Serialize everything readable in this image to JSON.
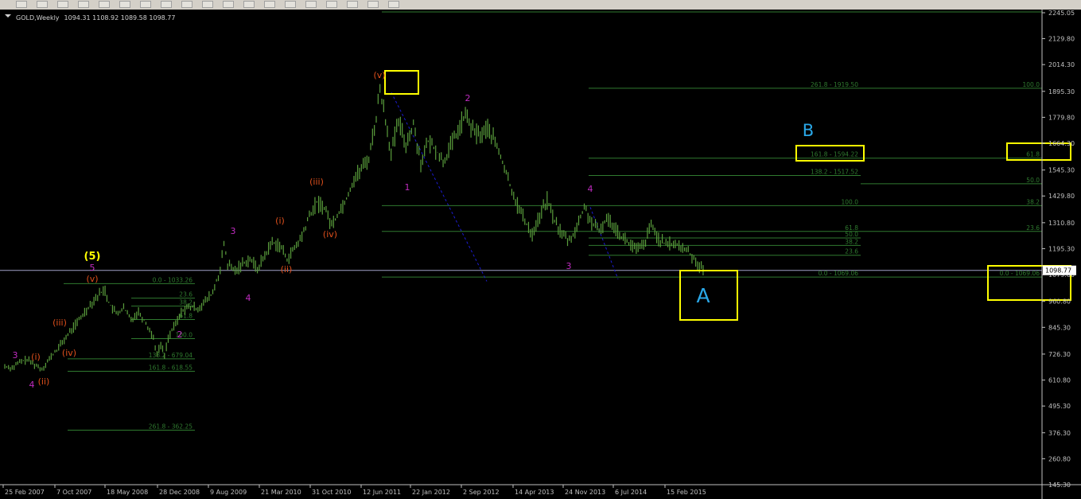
{
  "window": {
    "symbol_header": "GOLD,Weekly",
    "ohlc": "1094.31 1108.92 1089.58 1098.77",
    "current_price": "1098.77"
  },
  "toolbar": {
    "buttons": [
      "crosshair",
      "period-sep",
      "zoom-in",
      "zoom-out",
      "tile",
      "add-indicator",
      "globe",
      "fib-expansion",
      "fib-fan",
      "shapes",
      "M1",
      "M5",
      "M15",
      "M30",
      "H1",
      "H4",
      "D1",
      "W1",
      "MN"
    ]
  },
  "chart_data": {
    "type": "line",
    "title": "",
    "ylim": [
      145.3,
      2245.05
    ],
    "y_ticks": [
      2245.05,
      2129.8,
      2014.3,
      1895.3,
      1779.8,
      1664.3,
      1545.3,
      1429.8,
      1310.8,
      1195.3,
      1079.8,
      960.8,
      845.3,
      726.3,
      610.8,
      495.3,
      376.3,
      260.8,
      145.3
    ],
    "y_tick_labels": [
      "2245.05",
      "2129.80",
      "2014.30",
      "1895.30",
      "1779.80",
      "1664.30",
      "1545.30",
      "1429.80",
      "1310.80",
      "1195.30",
      "1079.80",
      "960.80",
      "845.30",
      "726.30",
      "610.80",
      "495.30",
      "376.30",
      "260.80",
      "145.30"
    ],
    "x_tick_labels": [
      "25 Feb 2007",
      "7 Oct 2007",
      "18 May 2008",
      "28 Dec 2008",
      "9 Aug 2009",
      "21 Mar 2010",
      "31 Oct 2010",
      "12 Jun 2011",
      "22 Jan 2012",
      "2 Sep 2012",
      "14 Apr 2013",
      "24 Nov 2013",
      "6 Jul 2014",
      "15 Feb 2015"
    ],
    "series": [
      {
        "values": [
          [
            0,
            672
          ],
          [
            2,
            665
          ],
          [
            4,
            690
          ],
          [
            6,
            702
          ],
          [
            8,
            680
          ],
          [
            10,
            660
          ],
          [
            12,
            705
          ],
          [
            14,
            745
          ],
          [
            16,
            790
          ],
          [
            18,
            835
          ],
          [
            20,
            878
          ],
          [
            22,
            925
          ],
          [
            24,
            968
          ],
          [
            26,
            1003
          ],
          [
            27,
            1011
          ],
          [
            28,
            955
          ],
          [
            30,
            905
          ],
          [
            32,
            930
          ],
          [
            34,
            880
          ],
          [
            36,
            915
          ],
          [
            38,
            865
          ],
          [
            40,
            800
          ],
          [
            41,
            725
          ],
          [
            42,
            770
          ],
          [
            43,
            720
          ],
          [
            44,
            800
          ],
          [
            46,
            860
          ],
          [
            48,
            925
          ],
          [
            50,
            935
          ],
          [
            52,
            930
          ],
          [
            54,
            960
          ],
          [
            56,
            1000
          ],
          [
            58,
            1100
          ],
          [
            59,
            1215
          ],
          [
            60,
            1125
          ],
          [
            62,
            1095
          ],
          [
            64,
            1130
          ],
          [
            66,
            1150
          ],
          [
            68,
            1105
          ],
          [
            70,
            1165
          ],
          [
            72,
            1225
          ],
          [
            74,
            1210
          ],
          [
            76,
            1150
          ],
          [
            78,
            1195
          ],
          [
            80,
            1250
          ],
          [
            82,
            1340
          ],
          [
            84,
            1400
          ],
          [
            86,
            1380
          ],
          [
            88,
            1300
          ],
          [
            90,
            1360
          ],
          [
            92,
            1420
          ],
          [
            94,
            1505
          ],
          [
            96,
            1550
          ],
          [
            98,
            1600
          ],
          [
            100,
            1780
          ],
          [
            101,
            1905
          ],
          [
            102,
            1820
          ],
          [
            104,
            1620
          ],
          [
            106,
            1760
          ],
          [
            108,
            1660
          ],
          [
            110,
            1750
          ],
          [
            112,
            1580
          ],
          [
            114,
            1670
          ],
          [
            116,
            1640
          ],
          [
            118,
            1580
          ],
          [
            120,
            1650
          ],
          [
            122,
            1720
          ],
          [
            124,
            1790
          ],
          [
            126,
            1720
          ],
          [
            128,
            1700
          ],
          [
            130,
            1730
          ],
          [
            132,
            1670
          ],
          [
            134,
            1580
          ],
          [
            136,
            1480
          ],
          [
            138,
            1390
          ],
          [
            140,
            1320
          ],
          [
            142,
            1260
          ],
          [
            144,
            1340
          ],
          [
            146,
            1410
          ],
          [
            148,
            1320
          ],
          [
            150,
            1260
          ],
          [
            152,
            1230
          ],
          [
            154,
            1290
          ],
          [
            156,
            1380
          ],
          [
            158,
            1310
          ],
          [
            160,
            1270
          ],
          [
            162,
            1330
          ],
          [
            164,
            1300
          ],
          [
            166,
            1250
          ],
          [
            168,
            1220
          ],
          [
            170,
            1190
          ],
          [
            172,
            1210
          ],
          [
            174,
            1300
          ],
          [
            176,
            1240
          ],
          [
            178,
            1210
          ],
          [
            180,
            1220
          ],
          [
            182,
            1200
          ],
          [
            184,
            1185
          ],
          [
            186,
            1140
          ],
          [
            188,
            1098.77
          ]
        ]
      }
    ],
    "fibonacci_levels": [
      {
        "label": "0.0 - 1033.26",
        "price": 1040
      },
      {
        "label": "23.6",
        "price": 975
      },
      {
        "label": "38.2",
        "price": 940
      },
      {
        "label": "61.8",
        "price": 880
      },
      {
        "label": "100.0",
        "price": 795
      },
      {
        "label": "138.2 - 679.04",
        "price": 705
      },
      {
        "label": "161.8 - 618.55",
        "price": 650
      },
      {
        "label": "261.8 - 362.25",
        "price": 388
      },
      {
        "label": "261.8 - 1919.50",
        "price": 1909
      },
      {
        "label": "100.0",
        "price": 1909
      },
      {
        "label": "161.8 - 1594.22",
        "price": 1598
      },
      {
        "label": "138.2 - 1517.52",
        "price": 1521
      },
      {
        "label": "61.8",
        "price": 1598
      },
      {
        "label": "50.0",
        "price": 1484
      },
      {
        "label": "100.0",
        "price": 1387
      },
      {
        "label": "38.2",
        "price": 1387
      },
      {
        "label": "61.8",
        "price": 1272
      },
      {
        "label": "23.6",
        "price": 1272
      },
      {
        "label": "50.0",
        "price": 1243
      },
      {
        "label": "38.2",
        "price": 1210
      },
      {
        "label": "23.6",
        "price": 1166
      },
      {
        "label": "0.0 - 1069.06",
        "price": 1069
      },
      {
        "label": "0.0 - 1069.06",
        "price": 1069
      }
    ],
    "wave_labels": [
      {
        "text": "3",
        "color": "#c02cc0"
      },
      {
        "text": "4",
        "color": "#c02cc0"
      },
      {
        "text": "(i)",
        "color": "#e0501c"
      },
      {
        "text": "(ii)",
        "color": "#e0501c"
      },
      {
        "text": "(iii)",
        "color": "#e0501c"
      },
      {
        "text": "(iv)",
        "color": "#e0501c"
      },
      {
        "text": "(v)",
        "color": "#e0501c"
      },
      {
        "text": "5",
        "color": "#c02cc0"
      },
      {
        "text": "(5)",
        "color": "#ffff00"
      },
      {
        "text": "2",
        "color": "#c02cc0"
      },
      {
        "text": "3",
        "color": "#c02cc0"
      },
      {
        "text": "4",
        "color": "#c02cc0"
      },
      {
        "text": "(i)",
        "color": "#e0501c"
      },
      {
        "text": "(ii)",
        "color": "#e0501c"
      },
      {
        "text": "(iii)",
        "color": "#e0501c"
      },
      {
        "text": "(iv)",
        "color": "#e0501c"
      },
      {
        "text": "(v)",
        "color": "#e0501c"
      },
      {
        "text": "1",
        "color": "#c02cc0"
      },
      {
        "text": "2",
        "color": "#c02cc0"
      },
      {
        "text": "3",
        "color": "#c02cc0"
      },
      {
        "text": "4",
        "color": "#c02cc0"
      },
      {
        "text": "B",
        "color": "#2aa8e8"
      },
      {
        "text": "A",
        "color": "#2aa8e8"
      }
    ],
    "colors": {
      "background": "#000000",
      "bars": "#5a9e3c",
      "fib": "#2f7a2f",
      "text": "#c0c0c0",
      "highlight": "#ffff00",
      "trend": "#1c1cd0",
      "price_line": "#a0a0c8"
    }
  }
}
